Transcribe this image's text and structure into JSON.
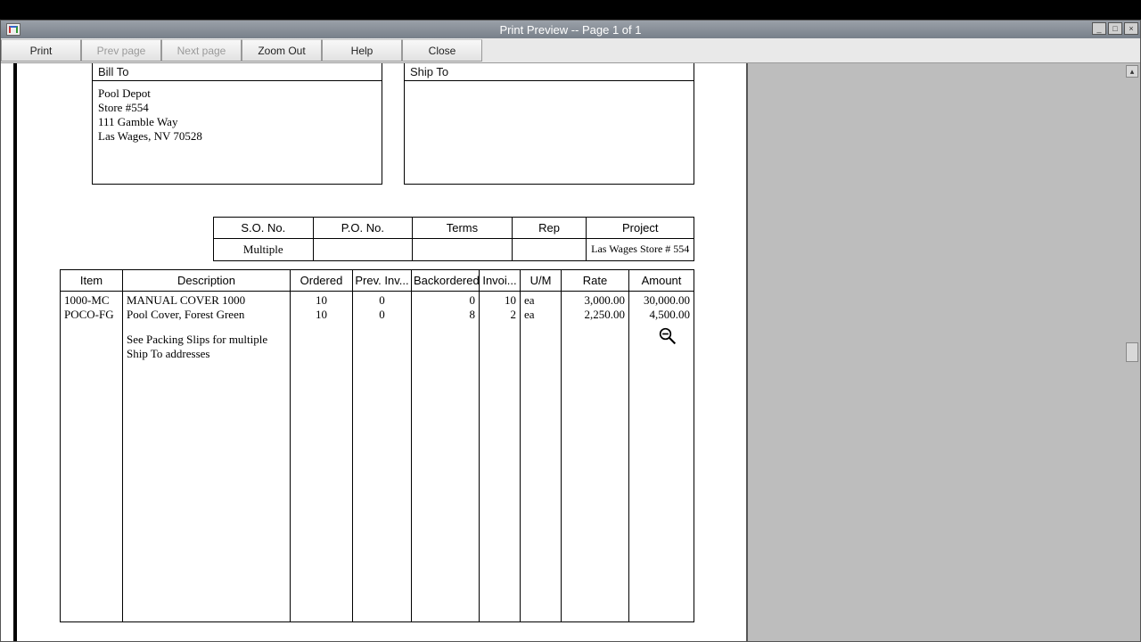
{
  "window": {
    "title": "Print Preview -- Page 1 of 1"
  },
  "toolbar": {
    "print": "Print",
    "prev": "Prev page",
    "next": "Next page",
    "zoom_out": "Zoom Out",
    "help": "Help",
    "close": "Close"
  },
  "bill_to": {
    "label": "Bill To",
    "line1": "Pool Depot",
    "line2": "Store #554",
    "line3": "111 Gamble Way",
    "line4": "Las Wages, NV 70528"
  },
  "ship_to": {
    "label": "Ship To"
  },
  "info": {
    "headers": {
      "so": "S.O. No.",
      "po": "P.O. No.",
      "terms": "Terms",
      "rep": "Rep",
      "project": "Project"
    },
    "values": {
      "so": "Multiple",
      "po": "",
      "terms": "",
      "rep": "",
      "project": "Las Wages Store # 554"
    }
  },
  "lines": {
    "headers": {
      "item": "Item",
      "description": "Description",
      "ordered": "Ordered",
      "prev_inv": "Prev. Inv...",
      "backordered": "Backordered",
      "invoiced": "Invoi...",
      "um": "U/M",
      "rate": "Rate",
      "amount": "Amount"
    },
    "rows": [
      {
        "item": "1000-MC",
        "description": "MANUAL COVER 1000",
        "ordered": "10",
        "prev_inv": "0",
        "backordered": "0",
        "invoiced": "10",
        "um": "ea",
        "rate": "3,000.00",
        "amount": "30,000.00"
      },
      {
        "item": "POCO-FG",
        "description": "Pool Cover, Forest Green",
        "ordered": "10",
        "prev_inv": "0",
        "backordered": "8",
        "invoiced": "2",
        "um": "ea",
        "rate": "2,250.00",
        "amount": "4,500.00"
      }
    ],
    "note": "See Packing Slips for multiple Ship To addresses"
  }
}
